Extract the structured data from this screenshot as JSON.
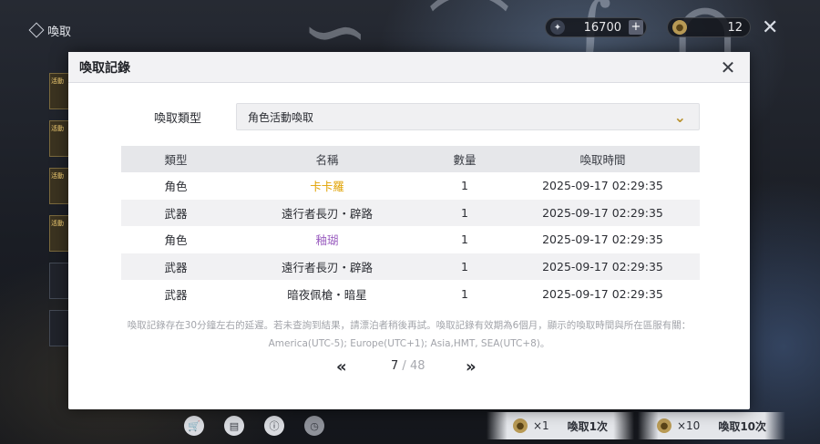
{
  "topbar": {
    "title": "喚取"
  },
  "currency": {
    "star_amount": "16700",
    "coin_amount": "12"
  },
  "side_cards": [
    "活動",
    "活動",
    "活動",
    "活動"
  ],
  "modal": {
    "title": "喚取記錄",
    "filter_label": "喚取類型",
    "filter_value": "角色活動喚取",
    "columns": [
      "類型",
      "名稱",
      "數量",
      "喚取時間"
    ],
    "rows": [
      {
        "type": "角色",
        "name": "卡卡羅",
        "qty": "1",
        "time": "2025-09-17 02:29:35",
        "name_color": "#e0a100"
      },
      {
        "type": "武器",
        "name": "遠行者長刃・辟路",
        "qty": "1",
        "time": "2025-09-17 02:29:35",
        "name_color": "#2b2d33"
      },
      {
        "type": "角色",
        "name": "釉瑚",
        "qty": "1",
        "time": "2025-09-17 02:29:35",
        "name_color": "#9b5fc0"
      },
      {
        "type": "武器",
        "name": "遠行者長刃・辟路",
        "qty": "1",
        "time": "2025-09-17 02:29:35",
        "name_color": "#2b2d33"
      },
      {
        "type": "武器",
        "name": "暗夜佩槍・暗星",
        "qty": "1",
        "time": "2025-09-17 02:29:35",
        "name_color": "#2b2d33"
      }
    ],
    "note_line1": "喚取記錄存在30分鐘左右的延遲。若未查詢到結果，請漂泊者稍後再試。喚取記錄有效期為6個月，顯示的喚取時間與所在區服有關：",
    "note_line2": "America(UTC-5); Europe(UTC+1); Asia,HMT, SEA(UTC+8)。",
    "pager": {
      "current": "7",
      "separator": " / ",
      "total": "48"
    }
  },
  "bottom": {
    "pull1_count": "×1",
    "pull1_label": "喚取1次",
    "pull10_count": "×10",
    "pull10_label": "喚取10次"
  }
}
